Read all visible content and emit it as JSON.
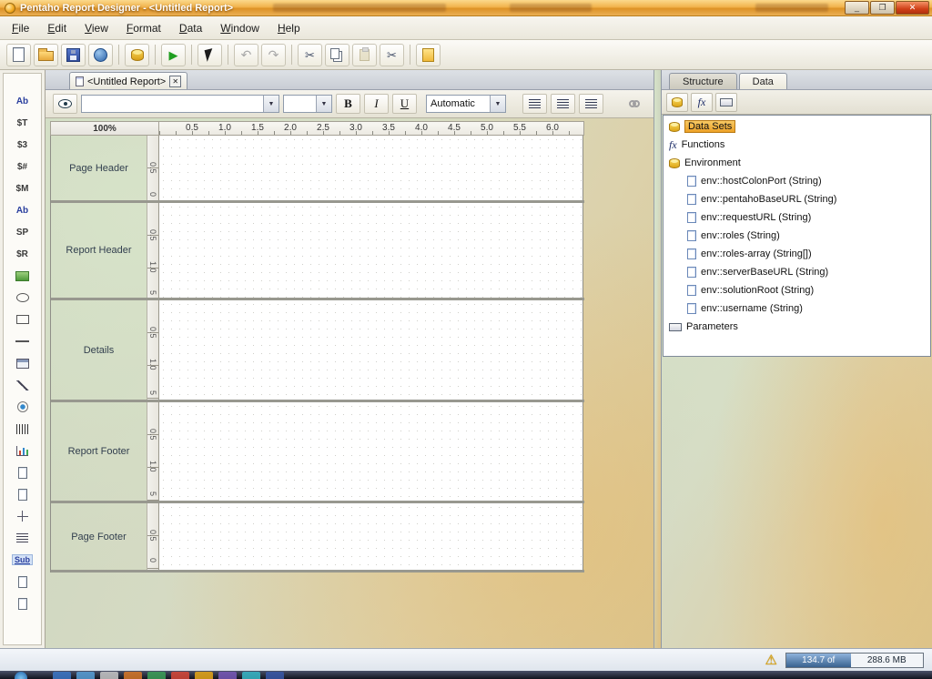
{
  "window": {
    "title": "Pentaho Report Designer - <Untitled Report>"
  },
  "titlebar_controls": {
    "minimize": "_",
    "maximize": "❐",
    "close": "✕"
  },
  "menubar": {
    "items": [
      "File",
      "Edit",
      "View",
      "Format",
      "Data",
      "Window",
      "Help"
    ]
  },
  "icons": {
    "preview": "▶",
    "undo": "↶",
    "redo": "↷",
    "cut": "✂",
    "delete": "✂",
    "dropdown_arrow": "▼",
    "function": "fx",
    "warning": "⚠",
    "tab_close": "✕"
  },
  "document_tab": {
    "label": "<Untitled Report>"
  },
  "format_toolbar": {
    "bold": "B",
    "italic": "I",
    "underline": "U",
    "font_name_value": "",
    "font_size_value": "",
    "font_color_value": "Automatic"
  },
  "ruler": {
    "zoom": "100%",
    "ticks": [
      "0.5",
      "1.0",
      "1.5",
      "2.0",
      "2.5",
      "3.0",
      "3.5",
      "4.0",
      "4.5",
      "5.0",
      "5.5",
      "6.0"
    ]
  },
  "bands": [
    {
      "label": "Page Header",
      "vticks": [
        "0.5",
        "0"
      ]
    },
    {
      "label": "Report Header",
      "vticks": [
        "0.5",
        "1.0",
        "5"
      ]
    },
    {
      "label": "Details",
      "vticks": [
        "0.5",
        "1.0",
        "5"
      ]
    },
    {
      "label": "Report Footer",
      "vticks": [
        "0.5",
        "1.0",
        "5"
      ]
    },
    {
      "label": "Page Footer",
      "vticks": [
        "0.5",
        "0"
      ]
    }
  ],
  "palette": {
    "items": [
      {
        "glyph": "Ab",
        "name": "label"
      },
      {
        "glyph": "$T",
        "name": "text-field"
      },
      {
        "glyph": "$3",
        "name": "number-field"
      },
      {
        "glyph": "$#",
        "name": "date-field"
      },
      {
        "glyph": "$M",
        "name": "message-field"
      },
      {
        "glyph": "Ab",
        "name": "resource-label"
      },
      {
        "glyph": "SP",
        "name": "resource-field"
      },
      {
        "glyph": "$R",
        "name": "resource-message"
      },
      {
        "name": "image"
      },
      {
        "name": "ellipse"
      },
      {
        "name": "rectangle"
      },
      {
        "name": "horizontal-line"
      },
      {
        "name": "table"
      },
      {
        "name": "line"
      },
      {
        "name": "survey-scale"
      },
      {
        "name": "barcode"
      },
      {
        "name": "chart"
      },
      {
        "name": "bar-sparkline"
      },
      {
        "name": "line-sparkline"
      },
      {
        "name": "crosstab"
      },
      {
        "name": "band"
      },
      {
        "glyph": "Sub",
        "name": "subreport"
      },
      {
        "name": "content"
      },
      {
        "name": "external-content"
      }
    ]
  },
  "right_panel": {
    "tabs": [
      {
        "label": "Structure"
      },
      {
        "label": "Data"
      }
    ],
    "tree": [
      {
        "label": "Data Sets"
      },
      {
        "label": "Functions"
      },
      {
        "label": "Environment"
      },
      {
        "label": "env::hostColonPort (String)"
      },
      {
        "label": "env::pentahoBaseURL (String)"
      },
      {
        "label": "env::requestURL (String)"
      },
      {
        "label": "env::roles (String)"
      },
      {
        "label": "env::roles-array (String[])"
      },
      {
        "label": "env::serverBaseURL (String)"
      },
      {
        "label": "env::solutionRoot (String)"
      },
      {
        "label": "env::username (String)"
      },
      {
        "label": "Parameters"
      }
    ]
  },
  "status_bar": {
    "memory_used": "134.7 of",
    "memory_total": "288.6 MB"
  }
}
